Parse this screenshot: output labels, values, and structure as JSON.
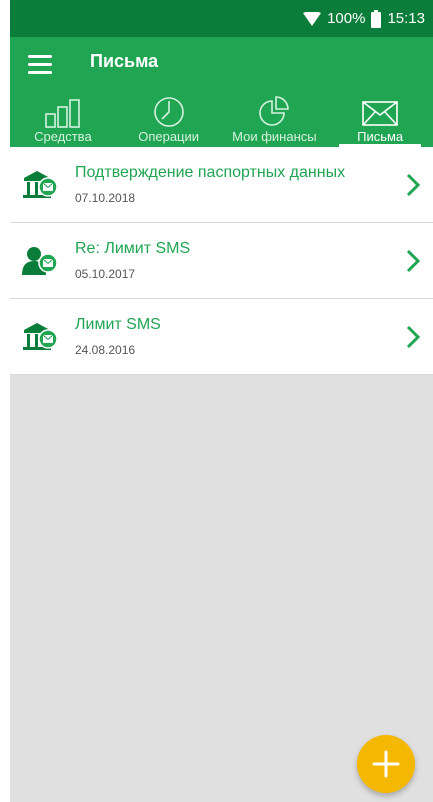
{
  "status_bar": {
    "battery": "100%",
    "time": "15:13"
  },
  "app_bar": {
    "title": "Письма"
  },
  "tabs": [
    {
      "label": "Средства",
      "icon": "bar-chart-icon",
      "active": false
    },
    {
      "label": "Операции",
      "icon": "clock-icon",
      "active": false
    },
    {
      "label": "Мои финансы",
      "icon": "pie-chart-icon",
      "active": false
    },
    {
      "label": "Письма",
      "icon": "envelope-icon",
      "active": true
    }
  ],
  "letters": [
    {
      "title": "Подтверждение паспортных данных",
      "date": "07.10.2018",
      "icon": "bank-mail-icon"
    },
    {
      "title": "Re: Лимит SMS",
      "date": "05.10.2017",
      "icon": "person-mail-icon"
    },
    {
      "title": "Лимит SMS",
      "date": "24.08.2016",
      "icon": "bank-mail-icon"
    }
  ],
  "colors": {
    "primary": "#20a553",
    "status_bar": "#0b7d3a",
    "fab": "#f5b800",
    "background": "#e0e0e0"
  }
}
